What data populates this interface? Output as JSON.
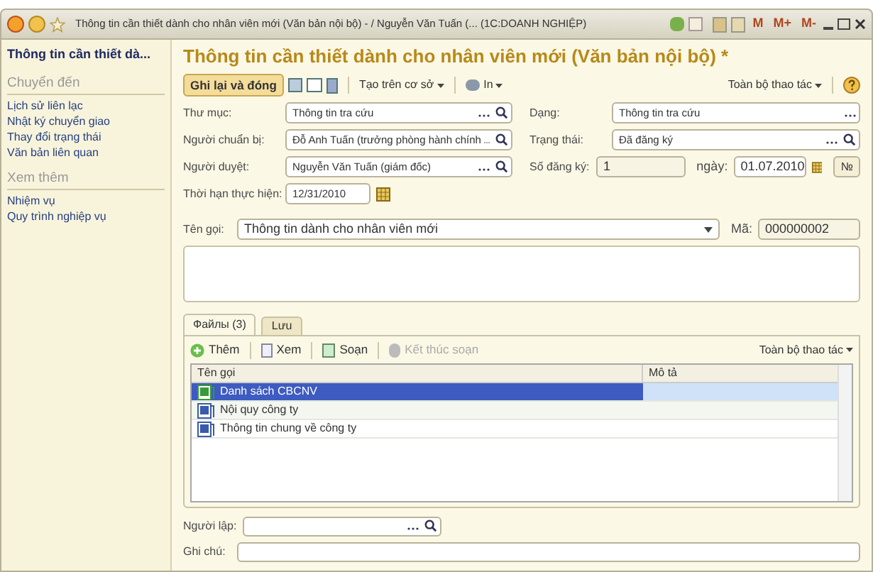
{
  "window": {
    "title": "Thông tin cần thiết dành cho nhân viên mới (Văn bản nội bộ) - / Nguyễn Văn Tuấn (... (1C:DOANH NGHIỆP)",
    "memory_buttons": [
      "M",
      "M+",
      "M-"
    ]
  },
  "sidebar": {
    "header": "Thông tin cần thiết dà...",
    "sections": [
      {
        "title": "Chuyển đến",
        "items": [
          "Lịch sử liên lạc",
          "Nhật ký chuyển giao",
          "Thay đổi trạng thái",
          "Văn bản liên quan"
        ]
      },
      {
        "title": "Xem thêm",
        "items": [
          "Nhiệm vụ",
          "Quy trình nghiệp vụ"
        ]
      }
    ]
  },
  "form": {
    "title": "Thông tin cần thiết dành cho nhân viên mới (Văn bản nội bộ) *",
    "toolbar": {
      "primary": "Ghi lại và đóng",
      "create_based": "Tạo trên cơ sở",
      "print": "In",
      "all_actions": "Toàn bộ thao tác"
    },
    "left_fields": [
      {
        "label": "Thư mục:",
        "value": "Thông tin tra cứu",
        "kind": "select"
      },
      {
        "label": "Người chuẩn bị:",
        "value": "Đỗ Anh Tuấn (trưởng phòng hành chính",
        "kind": "select"
      },
      {
        "label": "Người duyệt:",
        "value": "Nguyễn Văn Tuấn (giám đốc)",
        "kind": "select"
      },
      {
        "label": "Thời hạn thực hiện:",
        "value": "12/31/2010",
        "kind": "date"
      }
    ],
    "right_fields": [
      {
        "label": "Dạng:",
        "value": "Thông tin tra cứu",
        "kind": "choice"
      },
      {
        "label": "Trạng thái:",
        "value": "Đã đăng ký",
        "kind": "select"
      }
    ],
    "registration": {
      "label": "Số đăng ký:",
      "value": "1",
      "date_label": "ngày:",
      "date": "01.07.2010",
      "number_button": "№"
    },
    "name": {
      "label": "Tên gọi:",
      "value": "Thông tin dành cho nhân viên mới",
      "code_label": "Mã:",
      "code": "000000002"
    },
    "tabs": [
      {
        "label": "Файлы (3)",
        "selected": true
      },
      {
        "label": "Lưu",
        "selected": false
      }
    ],
    "files_toolbar": {
      "add": "Thêm",
      "view": "Xem",
      "edit": "Soạn",
      "finish": "Kết thúc soạn",
      "finish_disabled": true,
      "all_actions": "Toàn bộ thao tác"
    },
    "table": {
      "columns": [
        "Tên gọi",
        "Mô tả"
      ],
      "rows": [
        {
          "name": "Danh sách CBCNV",
          "kind": "excel",
          "selected": true
        },
        {
          "name": "Nội quy công ty",
          "kind": "word",
          "selected": false
        },
        {
          "name": "Thông tin chung về công ty",
          "kind": "word",
          "selected": false
        }
      ]
    },
    "author": {
      "label": "Người lập:"
    },
    "note": {
      "label": "Ghi chú:"
    }
  }
}
